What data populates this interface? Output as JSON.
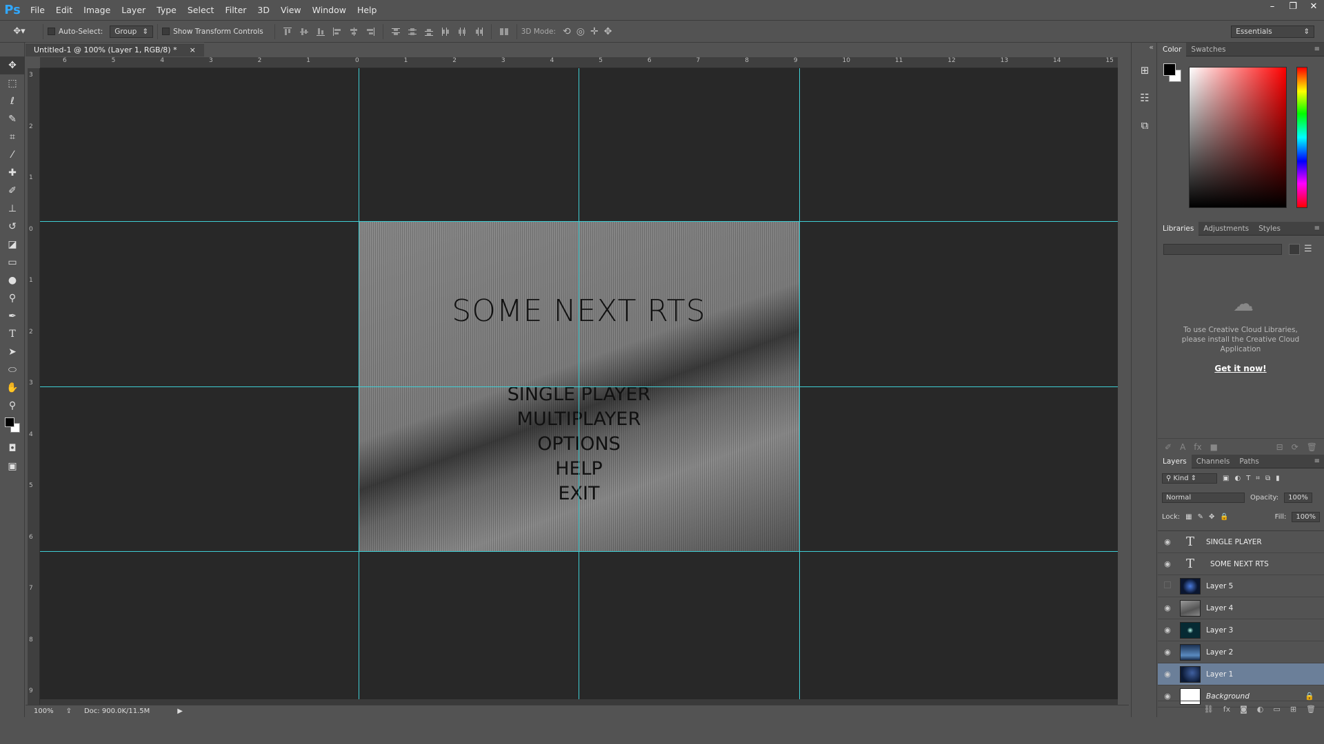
{
  "app": {
    "logo": "Ps"
  },
  "menubar": {
    "items": [
      "File",
      "Edit",
      "Image",
      "Layer",
      "Type",
      "Select",
      "Filter",
      "3D",
      "View",
      "Window",
      "Help"
    ]
  },
  "window_controls": {
    "minimize": "–",
    "restore": "❐",
    "close": "✕"
  },
  "options": {
    "auto_select_label": "Auto-Select:",
    "auto_select_value": "Group",
    "show_transform_label": "Show Transform Controls",
    "mode_3d_label": "3D Mode:",
    "workspace": "Essentials"
  },
  "document": {
    "tab_title": "Untitled-1 @ 100% (Layer 1, RGB/8) *",
    "tab_close": "×"
  },
  "rulers": {
    "h_ticks": [
      "6",
      "5",
      "4",
      "3",
      "2",
      "1",
      "0",
      "1",
      "2",
      "3",
      "4",
      "5",
      "6",
      "7",
      "8",
      "9",
      "10",
      "11",
      "12",
      "13",
      "14",
      "15"
    ],
    "v_ticks": [
      "3",
      "2",
      "1",
      "0",
      "1",
      "2",
      "3",
      "4",
      "5",
      "6",
      "7",
      "8",
      "9"
    ]
  },
  "artwork": {
    "title": "SOME NEXT RTS",
    "menu": [
      "SINGLE PLAYER",
      "MULTIPLAYER",
      "OPTIONS",
      "HELP",
      "EXIT"
    ]
  },
  "status": {
    "zoom": "100%",
    "doc": "Doc: 900.0K/11.5M"
  },
  "color_panel": {
    "tabs": [
      "Color",
      "Swatches"
    ]
  },
  "libraries_panel": {
    "tabs": [
      "Libraries",
      "Adjustments",
      "Styles"
    ],
    "message": "To use Creative Cloud Libraries, please install the Creative Cloud Application",
    "link": "Get it now!"
  },
  "layers_panel": {
    "tabs": [
      "Layers",
      "Channels",
      "Paths"
    ],
    "filter_kind": "Kind",
    "blend_mode": "Normal",
    "opacity_label": "Opacity:",
    "opacity_value": "100%",
    "lock_label": "Lock:",
    "fill_label": "Fill:",
    "fill_value": "100%",
    "layers": [
      {
        "name": "SINGLE PLAYER",
        "type": "text",
        "visible": true
      },
      {
        "name": "SOME NEXT RTS",
        "type": "text",
        "visible": true
      },
      {
        "name": "Layer 5",
        "type": "image",
        "visible": false,
        "thumb": "#0b1630"
      },
      {
        "name": "Layer 4",
        "type": "image",
        "visible": true,
        "thumb": "#7a7a7a"
      },
      {
        "name": "Layer 3",
        "type": "image",
        "visible": true,
        "thumb": "#062a33"
      },
      {
        "name": "Layer 2",
        "type": "image",
        "visible": true,
        "thumb": "#1b3050"
      },
      {
        "name": "Layer 1",
        "type": "image",
        "visible": true,
        "thumb": "#0c1a35",
        "selected": true
      },
      {
        "name": "Background",
        "type": "image",
        "visible": true,
        "thumb": "#ffffff",
        "locked": true
      }
    ]
  },
  "colors": {
    "accent": "#31a8ff",
    "guide": "#3fd0d6",
    "selection": "#6b7f99"
  }
}
